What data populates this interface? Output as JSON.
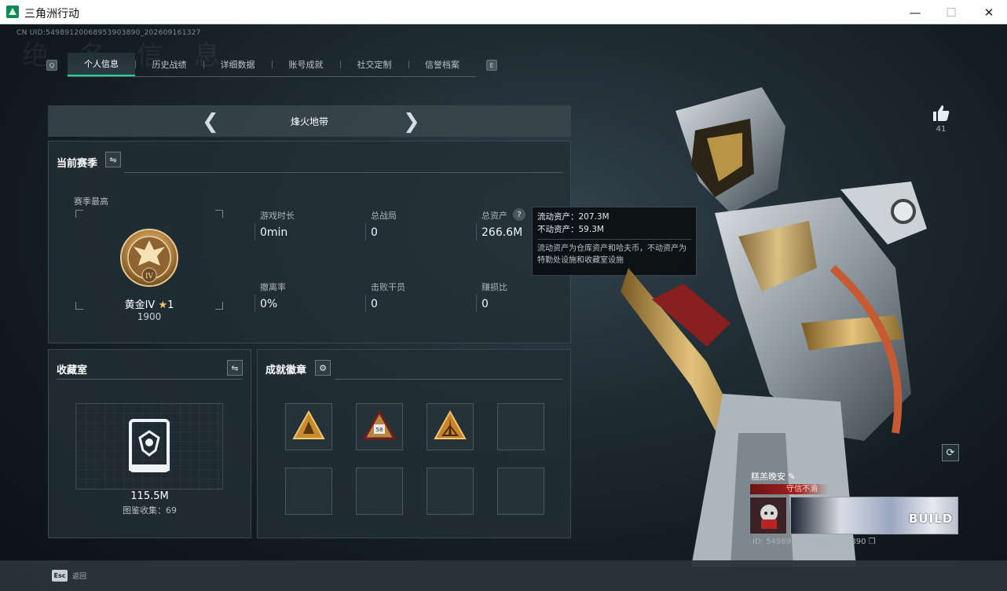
{
  "window": {
    "title": "三角洲行动",
    "minimize": "—",
    "maximize": "☐",
    "close": "✕"
  },
  "header": {
    "uid": "CN UID:549891200689539038​90_2026​09161327",
    "ghost": "绝 名 信 息",
    "left_key": "Q",
    "right_key": "E"
  },
  "tabs": [
    {
      "label": "个人信息"
    },
    {
      "label": "历史战绩"
    },
    {
      "label": "详细数据"
    },
    {
      "label": "账号成就"
    },
    {
      "label": "社交定制"
    },
    {
      "label": "信誉档案"
    }
  ],
  "mode": {
    "title": "烽火地带",
    "prev": "❮",
    "next": "❯"
  },
  "season": {
    "title": "当前赛季",
    "swap_icon": "⇋",
    "best_label": "赛季最高",
    "rank_name": "黄金IV",
    "rank_star": "★",
    "rank_star_count": "1",
    "rank_score": "1900",
    "medal_numeral": "IV",
    "stats": [
      {
        "label": "游戏时长",
        "value": "0min"
      },
      {
        "label": "总战局",
        "value": "0"
      },
      {
        "label": "总资产",
        "value": "266.6M"
      },
      {
        "label": "撤离率",
        "value": "0%"
      },
      {
        "label": "击败干员",
        "value": "0"
      },
      {
        "label": "赚损比",
        "value": "0"
      }
    ],
    "help": "?"
  },
  "tooltip": {
    "liquid": "流动资产：207.3M",
    "fixed": "不动资产：59.3M",
    "note": "流动资产为仓库资产和哈夫币，不动资产为特勤处设施和收藏室设施"
  },
  "collection": {
    "title": "收藏室",
    "swap_icon": "⇋",
    "value": "115.5M",
    "count_label": "图鉴收集：69"
  },
  "achievements": {
    "title": "成就徽章",
    "gear_icon": "⚙",
    "badge_number": "58"
  },
  "bottom": {
    "esc_key": "Esc",
    "esc_label": "返回"
  },
  "likes": {
    "count": "41"
  },
  "refresh_icon": "⟳",
  "player_card": {
    "name": "糕羔晚安",
    "edit_icon": "✎",
    "title": "守信不渝",
    "banner_text": "BUILD",
    "id": "ID: 5498912006895390389​0",
    "copy_icon": "❐"
  }
}
